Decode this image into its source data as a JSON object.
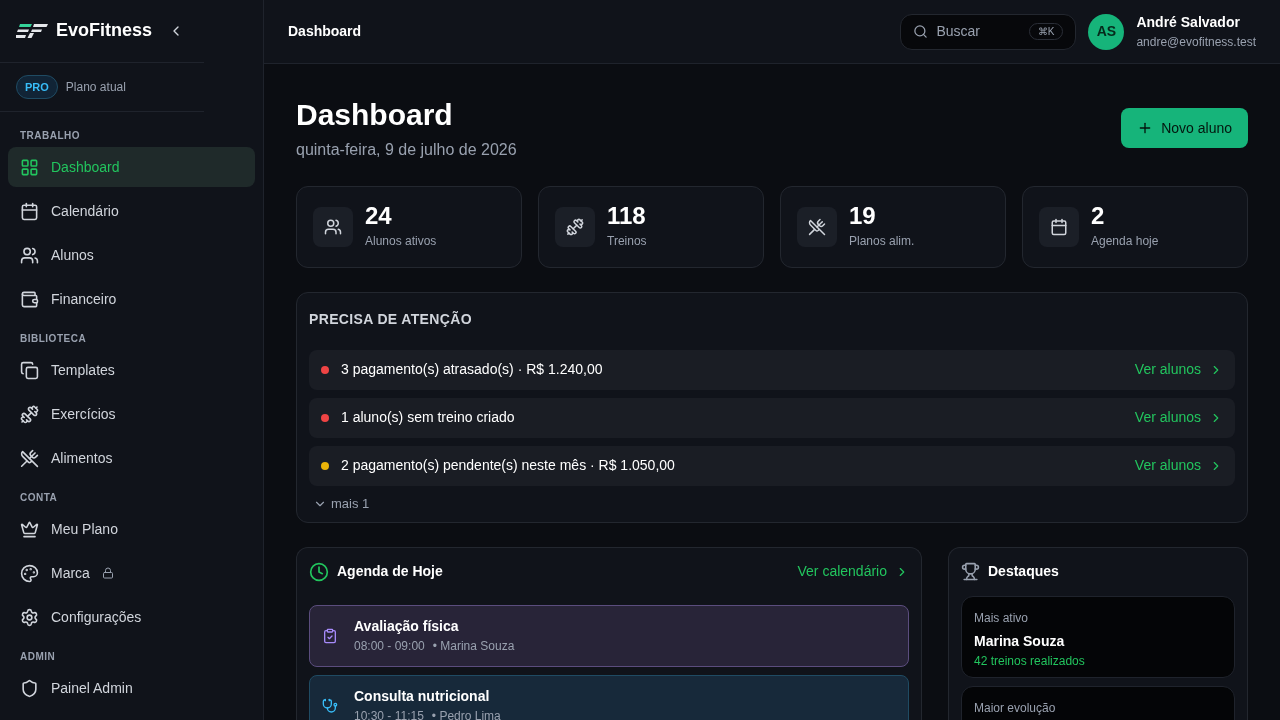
{
  "brand": {
    "name": "EvoFitness"
  },
  "plan": {
    "badge": "PRO",
    "label": "Plano atual"
  },
  "sidebar": {
    "sections": [
      {
        "title": "TRABALHO",
        "items": [
          {
            "label": "Dashboard",
            "selected": true
          },
          {
            "label": "Calendário",
            "selected": false
          },
          {
            "label": "Alunos",
            "selected": false
          },
          {
            "label": "Financeiro",
            "selected": false
          }
        ]
      },
      {
        "title": "BIBLIOTECA",
        "items": [
          {
            "label": "Templates",
            "selected": false
          },
          {
            "label": "Exercícios",
            "selected": false
          },
          {
            "label": "Alimentos",
            "selected": false
          }
        ]
      },
      {
        "title": "CONTA",
        "items": [
          {
            "label": "Meu Plano",
            "selected": false
          },
          {
            "label": "Marca",
            "selected": false,
            "locked": true
          },
          {
            "label": "Configurações",
            "selected": false
          }
        ]
      },
      {
        "title": "ADMIN",
        "items": [
          {
            "label": "Painel Admin",
            "selected": false
          }
        ]
      }
    ]
  },
  "header": {
    "title": "Dashboard",
    "search": {
      "placeholder": "Buscar",
      "shortcut": "⌘K"
    },
    "user": {
      "initials": "AS",
      "name": "André Salvador",
      "email": "andre@evofitness.test"
    }
  },
  "page": {
    "title": "Dashboard",
    "date": "quinta-feira, 9 de julho de 2026",
    "new_button": "Novo aluno"
  },
  "stats": [
    {
      "value": "24",
      "label": "Alunos ativos"
    },
    {
      "value": "118",
      "label": "Treinos"
    },
    {
      "value": "19",
      "label": "Planos alim."
    },
    {
      "value": "2",
      "label": "Agenda hoje"
    }
  ],
  "attention": {
    "title": "PRECISA DE ATENÇÃO",
    "items": [
      {
        "text": "3 pagamento(s) atrasado(s) · R$ 1.240,00",
        "color": "#ef4444",
        "link": "Ver alunos"
      },
      {
        "text": "1 aluno(s) sem treino criado",
        "color": "#ef4444",
        "link": "Ver alunos"
      },
      {
        "text": "2 pagamento(s) pendente(s) neste mês · R$ 1.050,00",
        "color": "#eab308",
        "link": "Ver alunos"
      }
    ],
    "more": "mais 1"
  },
  "agenda": {
    "title": "Agenda de Hoje",
    "link": "Ver calendário",
    "items": [
      {
        "kind": "assessment",
        "title": "Avaliação física",
        "time": "08:00 - 09:00",
        "person": "• Marina Souza"
      },
      {
        "kind": "consultation",
        "title": "Consulta nutricional",
        "time": "10:30 - 11:15",
        "person": "• Pedro Lima"
      }
    ]
  },
  "highlights": {
    "title": "Destaques",
    "items": [
      {
        "label": "Mais ativo",
        "name": "Marina Souza",
        "detail": "42 treinos realizados"
      },
      {
        "label": "Maior evolução"
      }
    ]
  }
}
